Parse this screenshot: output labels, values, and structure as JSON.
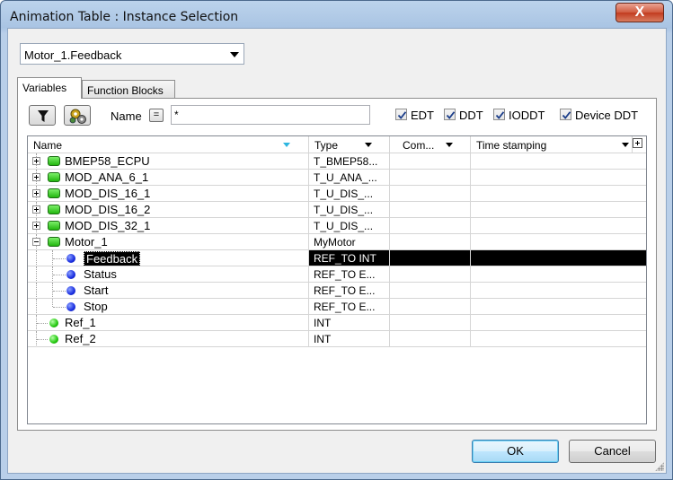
{
  "window": {
    "title": "Animation Table : Instance Selection",
    "close_glyph": "X"
  },
  "instance": {
    "value": "Motor_1.Feedback"
  },
  "tabs": [
    {
      "label": "Variables",
      "active": true
    },
    {
      "label": "Function Blocks",
      "active": false
    }
  ],
  "filter": {
    "name_label": "Name",
    "eq_label": "=",
    "name_value": "*",
    "checkboxes": [
      {
        "label": "EDT",
        "checked": true
      },
      {
        "label": "DDT",
        "checked": true
      },
      {
        "label": "IODDT",
        "checked": true
      },
      {
        "label": "Device DDT",
        "checked": true
      }
    ]
  },
  "grid": {
    "columns": [
      "Name",
      "Type",
      "Com...",
      "Time stamping"
    ],
    "rows": [
      {
        "name": "BMEP58_ECPU",
        "type": "T_BMEP58...",
        "icon": "ddt-green-icon",
        "level": 0,
        "expander": "plus"
      },
      {
        "name": "MOD_ANA_6_1",
        "type": "T_U_ANA_...",
        "icon": "ddt-green-icon",
        "level": 0,
        "expander": "plus"
      },
      {
        "name": "MOD_DIS_16_1",
        "type": "T_U_DIS_...",
        "icon": "ddt-green-icon",
        "level": 0,
        "expander": "plus"
      },
      {
        "name": "MOD_DIS_16_2",
        "type": "T_U_DIS_...",
        "icon": "ddt-green-icon",
        "level": 0,
        "expander": "plus"
      },
      {
        "name": "MOD_DIS_32_1",
        "type": "T_U_DIS_...",
        "icon": "ddt-green-icon",
        "level": 0,
        "expander": "plus"
      },
      {
        "name": "Motor_1",
        "type": "MyMotor",
        "icon": "ddt-green-icon",
        "level": 0,
        "expander": "minus"
      },
      {
        "name": "Feedback",
        "type": "REF_TO INT",
        "icon": "element-blue-icon",
        "level": 1,
        "selected": true
      },
      {
        "name": "Status",
        "type": "REF_TO E...",
        "icon": "element-blue-icon",
        "level": 1
      },
      {
        "name": "Start",
        "type": "REF_TO E...",
        "icon": "element-blue-icon",
        "level": 1
      },
      {
        "name": "Stop",
        "type": "REF_TO E...",
        "icon": "element-blue-icon",
        "level": 1
      },
      {
        "name": "Ref_1",
        "type": "INT",
        "icon": "ebool-green-icon",
        "level": 0
      },
      {
        "name": "Ref_2",
        "type": "INT",
        "icon": "ebool-green-icon",
        "level": 0
      }
    ]
  },
  "buttons": {
    "ok": "OK",
    "cancel": "Cancel"
  },
  "colors": {
    "selection": "#000000",
    "ddt_icon": "#22b60e",
    "element_icon": "#1a2ee0",
    "title_bar": "#a9c4e3"
  }
}
